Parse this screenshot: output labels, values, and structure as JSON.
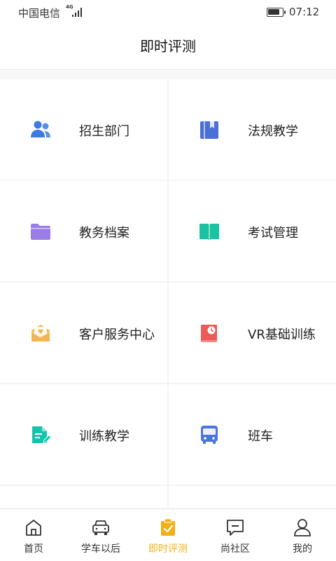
{
  "status_bar": {
    "carrier": "中国电信",
    "network": "4G",
    "time": "07:12",
    "battery_level": 0.85
  },
  "header": {
    "title": "即时评测"
  },
  "grid": {
    "items": [
      {
        "label": "招生部门",
        "icon": "people-icon",
        "color": "#3d7be0"
      },
      {
        "label": "法规教学",
        "icon": "book-icon",
        "color": "#4a6fd6"
      },
      {
        "label": "教务档案",
        "icon": "folder-icon",
        "color": "#9b7de6"
      },
      {
        "label": "考试管理",
        "icon": "open-book-icon",
        "color": "#19c2a0"
      },
      {
        "label": "客户服务中心",
        "icon": "mail-heart-icon",
        "color": "#f2b552"
      },
      {
        "label": "VR基础训练",
        "icon": "clock-book-icon",
        "color": "#ec5b56"
      },
      {
        "label": "训练教学",
        "icon": "edit-document-icon",
        "color": "#16c4ad"
      },
      {
        "label": "班车",
        "icon": "bus-icon",
        "color": "#4a74e0"
      }
    ]
  },
  "tab_bar": {
    "active_color": "#f0b019",
    "inactive_color": "#333333",
    "tabs": [
      {
        "label": "首页",
        "icon": "home-icon"
      },
      {
        "label": "学车以后",
        "icon": "car-icon"
      },
      {
        "label": "即时评测",
        "icon": "clipboard-check-icon",
        "active": true
      },
      {
        "label": "尚社区",
        "icon": "chat-icon"
      },
      {
        "label": "我的",
        "icon": "user-icon"
      }
    ]
  }
}
